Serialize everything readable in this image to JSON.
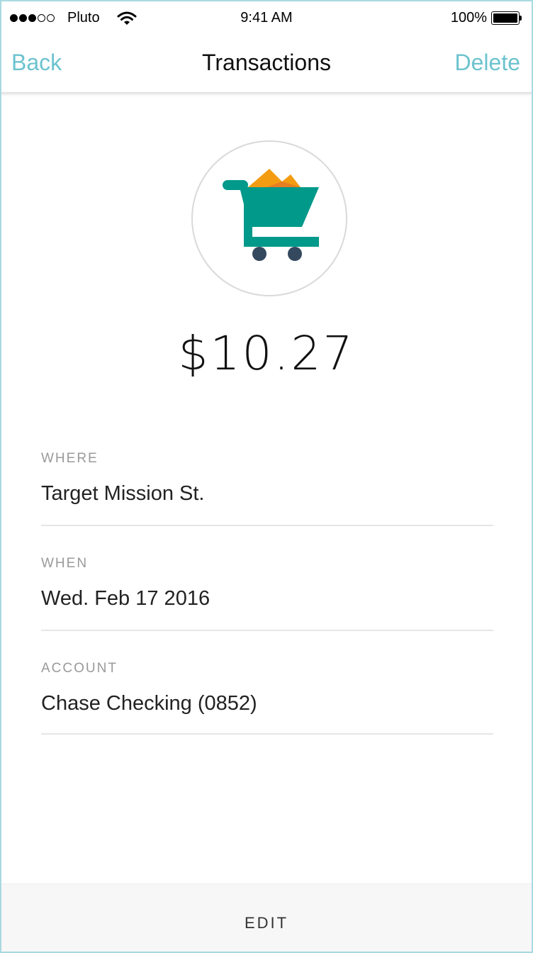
{
  "status_bar": {
    "carrier": "Pluto",
    "time": "9:41 AM",
    "battery": "100%",
    "signal_bars_filled": 3,
    "signal_bars_total": 5
  },
  "nav": {
    "back_label": "Back",
    "title": "Transactions",
    "delete_label": "Delete"
  },
  "transaction": {
    "icon": "shopping-cart-icon",
    "amount": "$10.27"
  },
  "details": {
    "where": {
      "label": "WHERE",
      "value": "Target Mission St."
    },
    "when": {
      "label": "WHEN",
      "value": "Wed. Feb 17 2016"
    },
    "account": {
      "label": "ACCOUNT",
      "value": "Chase Checking (0852)"
    }
  },
  "footer": {
    "edit_label": "EDIT"
  },
  "colors": {
    "accent": "#6cc3cf",
    "cart_teal": "#00998a",
    "cart_items": "#f39c12",
    "wheels": "#34495e"
  }
}
